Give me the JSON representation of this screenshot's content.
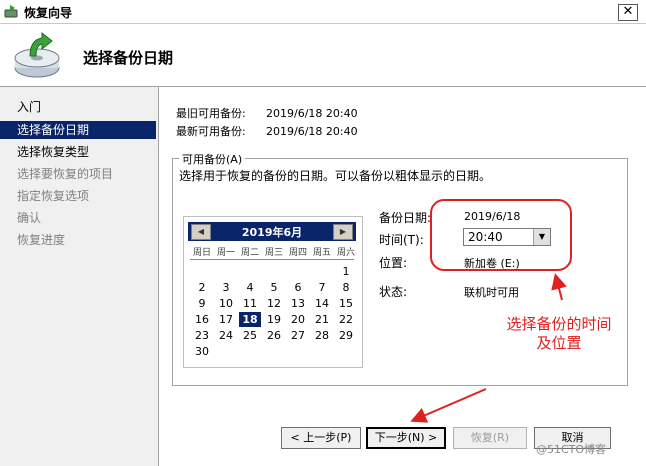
{
  "window": {
    "title": "恢复向导",
    "close_glyph": "✕"
  },
  "header": {
    "page_title": "选择备份日期"
  },
  "sidebar": {
    "items": [
      {
        "label": "入门",
        "state": "normal"
      },
      {
        "label": "选择备份日期",
        "state": "active"
      },
      {
        "label": "选择恢复类型",
        "state": "normal"
      },
      {
        "label": "选择要恢复的项目",
        "state": "disabled"
      },
      {
        "label": "指定恢复选项",
        "state": "disabled"
      },
      {
        "label": "确认",
        "state": "disabled"
      },
      {
        "label": "恢复进度",
        "state": "disabled"
      }
    ]
  },
  "backup_info": {
    "oldest_label": "最旧可用备份:",
    "oldest_value": "2019/6/18 20:40",
    "newest_label": "最新可用备份:",
    "newest_value": "2019/6/18 20:40"
  },
  "available": {
    "group_title": "可用备份(A)",
    "description": "选择用于恢复的备份的日期。可以备份以粗体显示的日期。"
  },
  "calendar": {
    "month_title": "2019年6月",
    "weekdays": [
      "周日",
      "周一",
      "周二",
      "周三",
      "周四",
      "周五",
      "周六"
    ],
    "days": [
      "1",
      "2",
      "3",
      "4",
      "5",
      "6",
      "7",
      "8",
      "9",
      "10",
      "11",
      "12",
      "13",
      "14",
      "15",
      "16",
      "17",
      "18",
      "19",
      "20",
      "21",
      "22",
      "23",
      "24",
      "25",
      "26",
      "27",
      "28",
      "29",
      "30"
    ],
    "first_weekday_index": 6,
    "selected_day": "18"
  },
  "details": {
    "date_label": "备份日期:",
    "date_value": "2019/6/18",
    "time_label": "时间(T):",
    "time_value": "20:40",
    "location_label": "位置:",
    "location_value": "新加卷  (E:)",
    "status_label": "状态:",
    "status_value": "联机时可用"
  },
  "annotation": {
    "text": "选择备份的时间及位置",
    "color": "#e02020"
  },
  "buttons": {
    "back": "< 上一步(P)",
    "next": "下一步(N) >",
    "recover": "恢复(R)",
    "cancel": "取消"
  },
  "watermark": "@51CTO博客",
  "colors": {
    "accent": "#0a246a",
    "annotation": "#e02020"
  }
}
